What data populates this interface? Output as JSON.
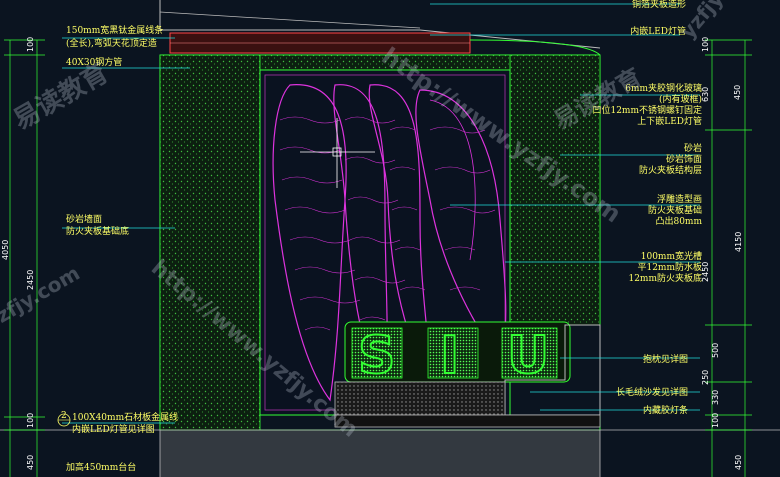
{
  "labels_left": {
    "strip": "150mm宽黑钛金属线条",
    "strip2": "(全长),弯弧天花顶定造",
    "tube": "40X30钢方管",
    "wall1": "砂岩墙面",
    "wall2": "防火夹板基础底",
    "floor_detail_a": "100X40mm石材板金属线",
    "floor_detail_b": "内嵌LED灯管见详图",
    "floor_detail_c": "加高450mm台台",
    "callout_num": "2"
  },
  "labels_right": {
    "top": "铜箔夹板造形",
    "led": "内嵌LED灯管",
    "glass1": "6mm夹胶钢化玻璃",
    "glass2": "(内有玻框)",
    "glass3": "凹位12mm不锈钢螺钉固定",
    "glass4": "上下嵌LED灯管",
    "stone1": "砂岩",
    "stone2": "砂岩饰面",
    "stone3": "防火夹板结构层",
    "relief1": "浮雕造型画",
    "relief2": "防火夹板基础",
    "relief3": "凸出80mm",
    "panel1": "100mm宽光槽",
    "panel2": "平12mm防水板",
    "panel3": "12mm防火夹板底",
    "sofa1": "抱枕见详图",
    "sofa2": "长毛绒沙发见详图",
    "sofa3": "内藏胶灯条"
  },
  "dims_left": [
    "100",
    "4050",
    "2450",
    "100",
    "450"
  ],
  "dims_right": [
    "100",
    "630",
    "450",
    "4150",
    "2450",
    "500",
    "250",
    "330",
    "100",
    "450"
  ],
  "sign_letters": [
    "S",
    "I",
    "U"
  ],
  "watermarks": [
    "易读教育",
    "http://www.yzfjy.com",
    "yzfjy.com"
  ],
  "icons": {
    "crosshair": "crosshair-cursor-icon",
    "callout": "section-callout-icon"
  },
  "colors": {
    "background": "#0b1420",
    "text": "#ffff66",
    "leader": "#22dddd",
    "outline": "#33ff33",
    "relief": "#dd33dd",
    "stone": "#1d3a1d"
  }
}
